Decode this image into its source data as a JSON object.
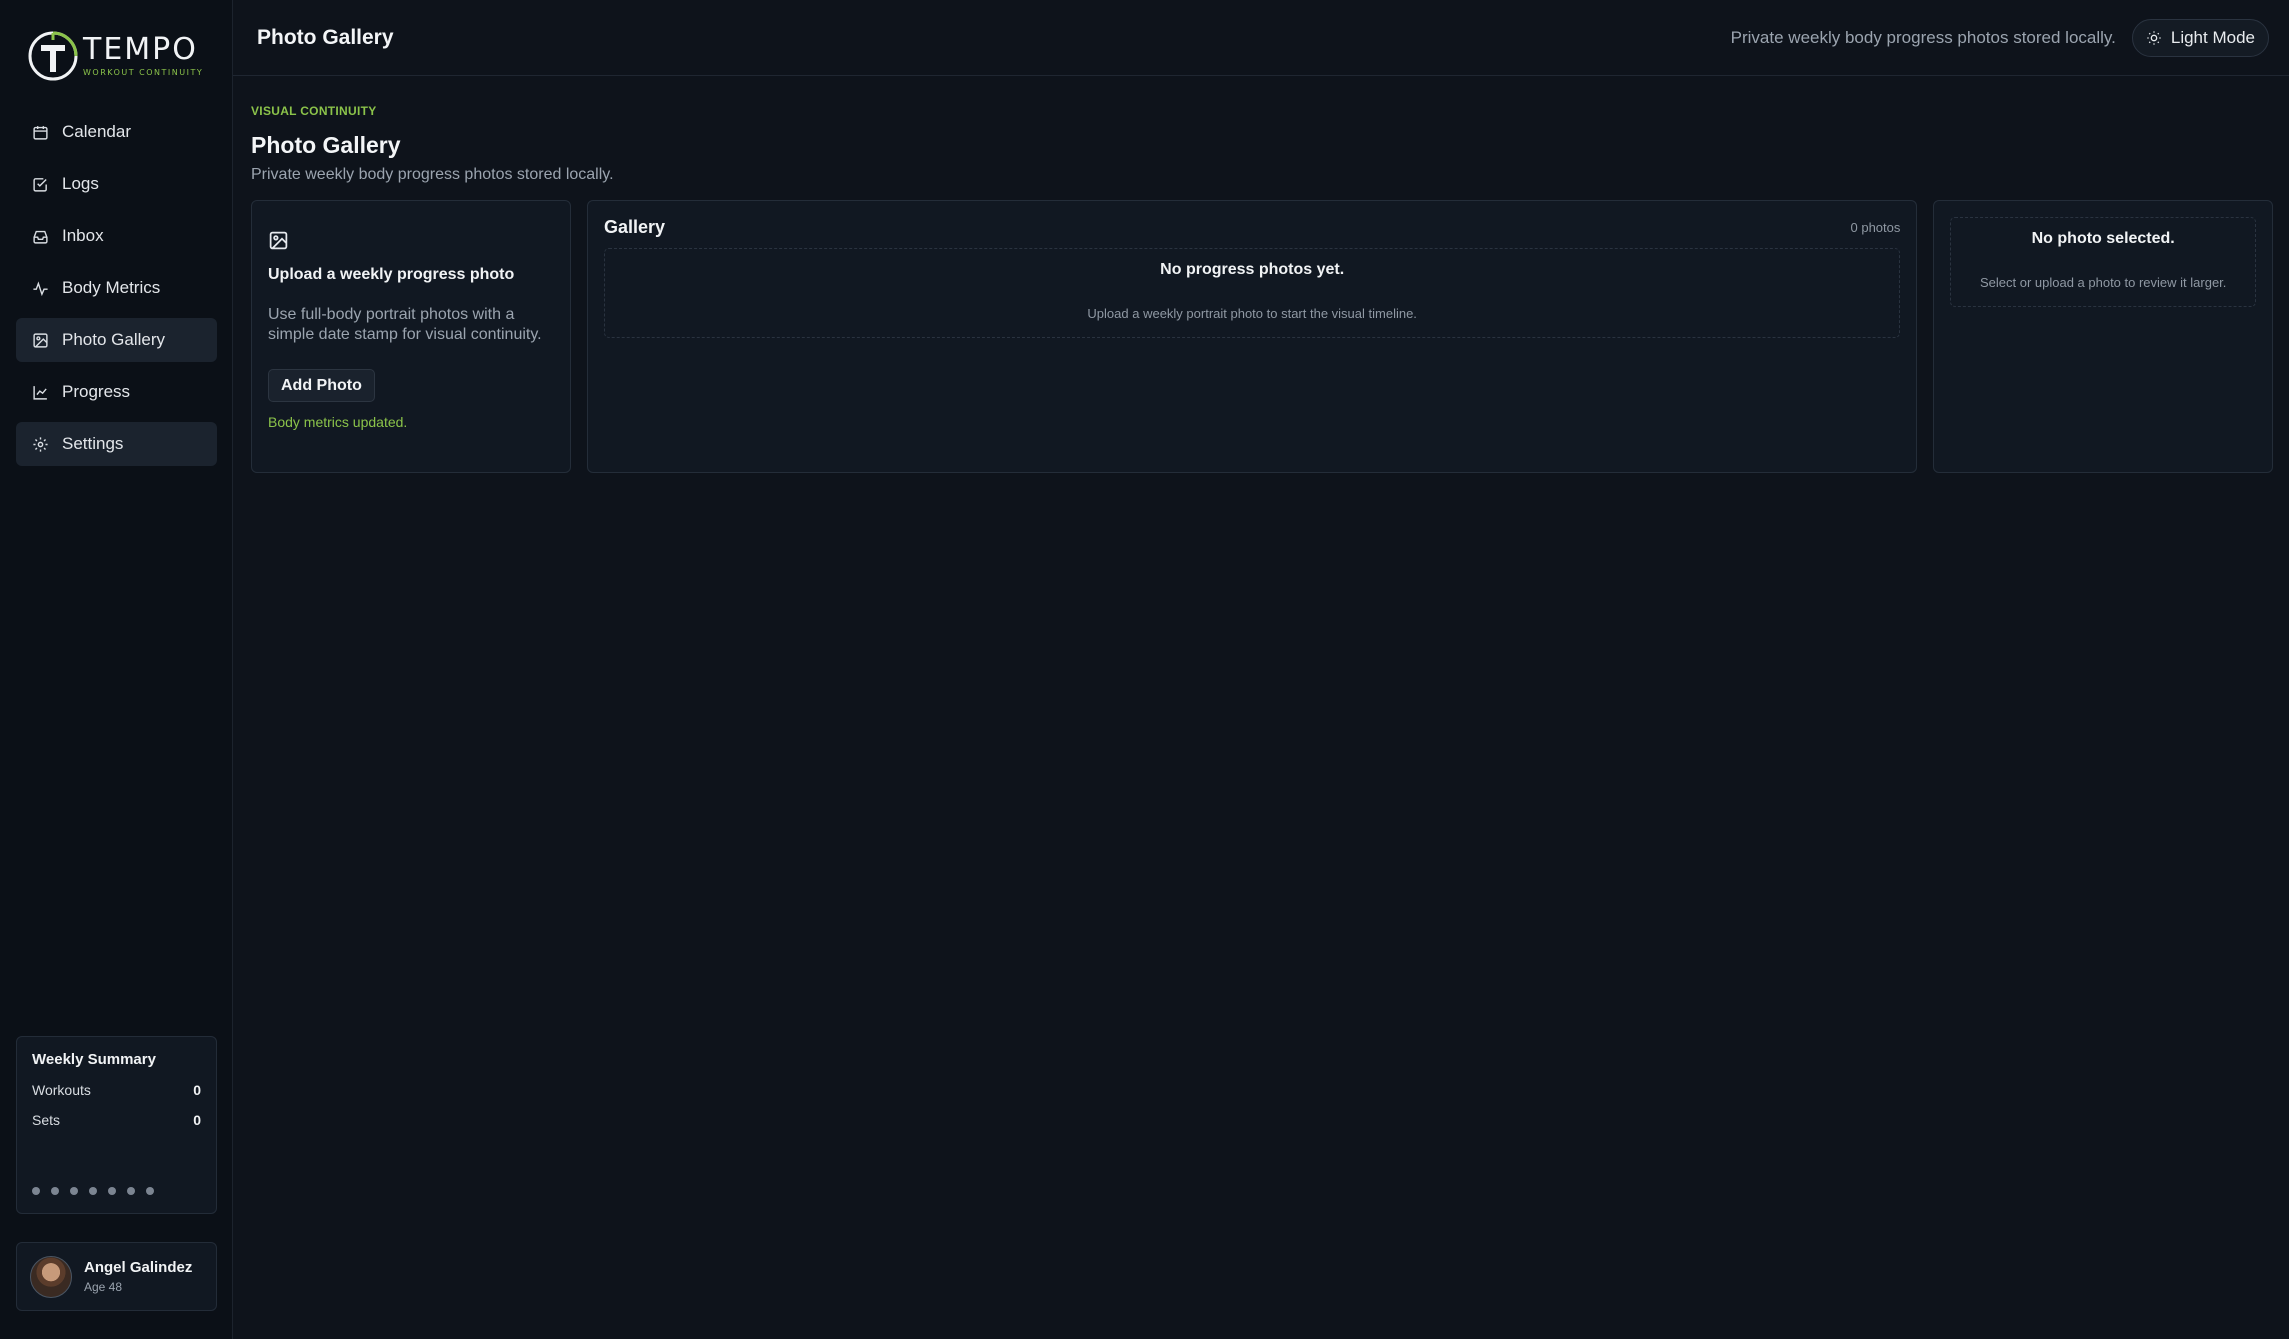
{
  "brand": {
    "name": "TEMPO",
    "tagline": "WORKOUT CONTINUITY",
    "accent": "#8bc34a"
  },
  "sidebar": {
    "items": [
      {
        "label": "Calendar",
        "icon": "calendar-icon"
      },
      {
        "label": "Logs",
        "icon": "checkbox-icon"
      },
      {
        "label": "Inbox",
        "icon": "inbox-icon"
      },
      {
        "label": "Body Metrics",
        "icon": "pulse-icon"
      },
      {
        "label": "Photo Gallery",
        "icon": "image-icon",
        "active": true
      },
      {
        "label": "Progress",
        "icon": "line-chart-icon"
      },
      {
        "label": "Settings",
        "icon": "gear-icon"
      }
    ],
    "weekly_summary": {
      "title": "Weekly Summary",
      "workouts_label": "Workouts",
      "workouts_value": "0",
      "sets_label": "Sets",
      "sets_value": "0"
    },
    "user": {
      "name": "Angel Galindez",
      "age": "Age 48"
    }
  },
  "header": {
    "title": "Photo Gallery",
    "note": "Private weekly body progress photos stored locally.",
    "theme_button": "Light Mode"
  },
  "page": {
    "eyebrow": "VISUAL CONTINUITY",
    "title": "Photo Gallery",
    "subtitle": "Private weekly body progress photos stored locally."
  },
  "upload": {
    "title": "Upload a weekly progress photo",
    "description": "Use full-body portrait photos with a simple date stamp for visual continuity.",
    "button": "Add Photo",
    "status": "Body metrics updated."
  },
  "gallery": {
    "title": "Gallery",
    "count": "0 photos",
    "empty_title": "No progress photos yet.",
    "empty_subtitle": "Upload a weekly portrait photo to start the visual timeline."
  },
  "viewer": {
    "title": "No photo selected.",
    "subtitle": "Select or upload a photo to review it larger."
  }
}
